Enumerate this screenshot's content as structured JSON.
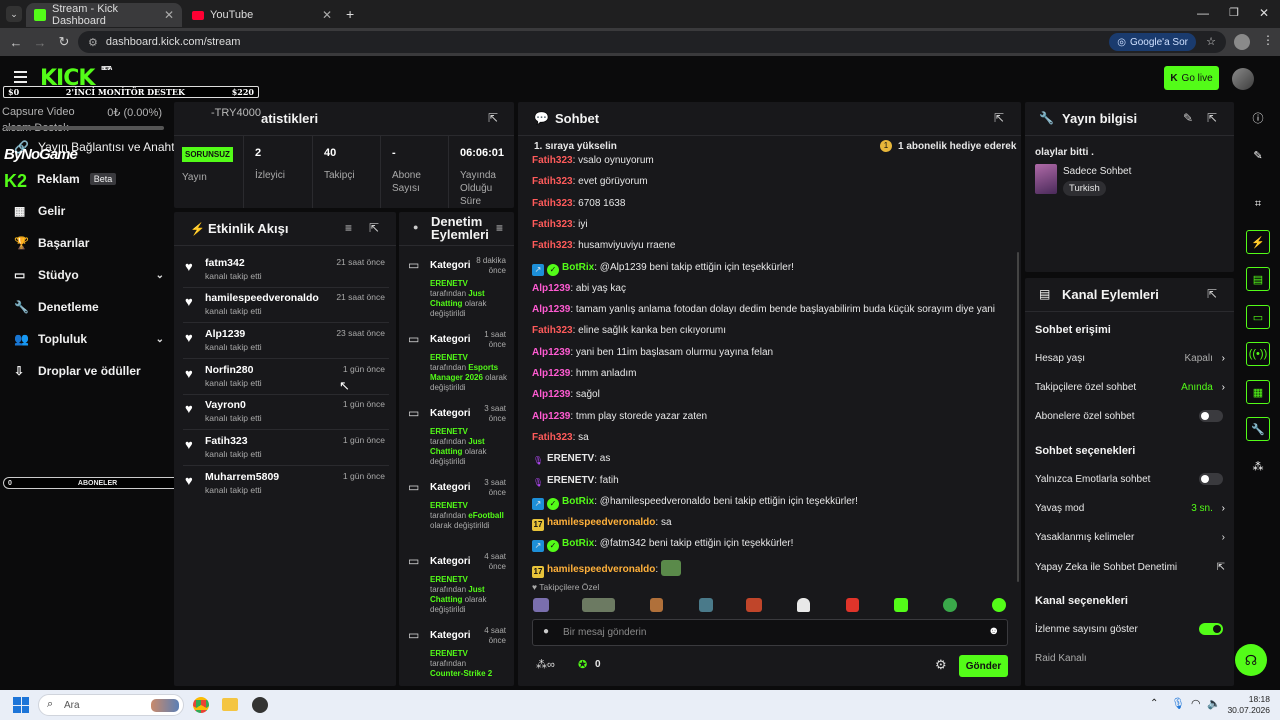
{
  "browser": {
    "tabs": [
      {
        "label": "Stream - Kick Dashboard",
        "active": true
      },
      {
        "label": "YouTube",
        "active": false
      }
    ],
    "url": "dashboard.kick.com/stream",
    "google_button": "Google'a Sor"
  },
  "header": {
    "logo": "KICK",
    "logo_tag": "BETA",
    "go_live": "Go live"
  },
  "overlay_top": {
    "left": "$0",
    "center": "2'İNCİ MONİTÖR DESTEK",
    "right": "$220"
  },
  "overlay_bottom": {
    "left": "0",
    "center": "ABONELER",
    "right": "10"
  },
  "overlay_ghost": {
    "line1": "Capsure Video",
    "line2": "0₺ (0.00%)",
    "line3": "alcam Destek",
    "line4": "ByNoGame",
    "try": "-TRY4000"
  },
  "sidebar": {
    "items": [
      {
        "label": "Yayın Bağlantısı ve Anahtarı"
      },
      {
        "label": "Reklam",
        "badge": "Beta"
      },
      {
        "label": "Gelir"
      },
      {
        "label": "Başarılar"
      },
      {
        "label": "Stüdyo"
      },
      {
        "label": "Denetleme"
      },
      {
        "label": "Topluluk"
      },
      {
        "label": "Droplar ve ödüller"
      }
    ]
  },
  "stats": {
    "title": "atistikleri",
    "items": [
      {
        "value": "SORUNSUZ",
        "label": "Yayın"
      },
      {
        "value": "2",
        "label": "İzleyici"
      },
      {
        "value": "40",
        "label": "Takipçi"
      },
      {
        "value": "-",
        "label": "Abone Sayısı"
      },
      {
        "value": "06:06:01",
        "label": "Yayında Olduğu Süre"
      }
    ]
  },
  "activity": {
    "title": "Etkinlik Akışı",
    "items": [
      {
        "name": "fatm342",
        "sub": "kanalı takip etti",
        "time": "21 saat önce"
      },
      {
        "name": "hamilespeedveronaldo",
        "sub": "kanalı takip etti",
        "time": "21 saat önce"
      },
      {
        "name": "Alp1239",
        "sub": "kanalı takip etti",
        "time": "23 saat önce"
      },
      {
        "name": "Norfin280",
        "sub": "kanalı takip etti",
        "time": "1 gün önce"
      },
      {
        "name": "Vayron0",
        "sub": "kanalı takip etti",
        "time": "1 gün önce"
      },
      {
        "name": "Fatih323",
        "sub": "kanalı takip etti",
        "time": "1 gün önce"
      },
      {
        "name": "Muharrem5809",
        "sub": "kanalı takip etti",
        "time": "1 gün önce"
      }
    ]
  },
  "moderation": {
    "title": "Denetim Eylemleri",
    "items": [
      {
        "kind": "Kategori",
        "time": "8 dakika önce",
        "actor": "ERENETV",
        "pre": "tarafından",
        "value": "Just Chatting",
        "post": "olarak değiştirildi"
      },
      {
        "kind": "Kategori",
        "time": "1 saat önce",
        "actor": "ERENETV",
        "pre": "tarafından",
        "value": "Esports Manager 2026",
        "post": "olarak değiştirildi"
      },
      {
        "kind": "Kategori",
        "time": "3 saat önce",
        "actor": "ERENETV",
        "pre": "tarafından",
        "value": "Just Chatting",
        "post": "olarak değiştirildi"
      },
      {
        "kind": "Kategori",
        "time": "3 saat önce",
        "actor": "ERENETV",
        "pre": "tarafından",
        "value": "eFootball",
        "post": "olarak değiştirildi"
      },
      {
        "kind": "Kategori",
        "time": "4 saat önce",
        "actor": "ERENETV",
        "pre": "tarafından",
        "value": "Just Chatting",
        "post": "olarak değiştirildi"
      },
      {
        "kind": "Kategori",
        "time": "4 saat önce",
        "actor": "ERENETV",
        "pre": "tarafından",
        "value": "Counter-Strike 2",
        "post": ""
      }
    ]
  },
  "chat": {
    "title": "Sohbet",
    "pinned_left": "1. sıraya yükselin",
    "pinned_right": "1 abonelik hediye ederek",
    "messages": [
      {
        "user": "Fatih323",
        "color": "red",
        "text": "vsalo oynuyorum"
      },
      {
        "user": "Fatih323",
        "color": "red",
        "text": "evet görüyorum"
      },
      {
        "user": "Fatih323",
        "color": "red",
        "text": "6708 1638"
      },
      {
        "user": "Fatih323",
        "color": "red",
        "text": "iyi"
      },
      {
        "user": "Fatih323",
        "color": "red",
        "text": "husamviyuviyu rraene"
      },
      {
        "user": "BotRix",
        "color": "green",
        "text": "@Alp1239 beni takip ettiğin için teşekkürler!",
        "bot": true
      },
      {
        "user": "Alp1239",
        "color": "pink",
        "text": "abi yaş kaç"
      },
      {
        "user": "Alp1239",
        "color": "pink",
        "text": "tamam yanlış anlama fotodan dolayı dedim bende başlayabilirim buda küçük sorayım diye yani"
      },
      {
        "user": "Fatih323",
        "color": "red",
        "text": "eline sağlık kanka ben cıkıyorumı"
      },
      {
        "user": "Alp1239",
        "color": "pink",
        "text": "yani ben 11im başlasam olurmu yayına felan"
      },
      {
        "user": "Alp1239",
        "color": "pink",
        "text": "hmm anladım"
      },
      {
        "user": "Alp1239",
        "color": "pink",
        "text": "sağol"
      },
      {
        "user": "Alp1239",
        "color": "pink",
        "text": "tmm play storede yazar zaten"
      },
      {
        "user": "Fatih323",
        "color": "red",
        "text": "sa"
      },
      {
        "user": "ERENETV",
        "color": "white",
        "text": "as",
        "mic": true
      },
      {
        "user": "ERENETV",
        "color": "white",
        "text": "fatih",
        "mic": true
      },
      {
        "user": "BotRix",
        "color": "green",
        "text": "@hamilespeedveronaldo beni takip ettiğin için teşekkürler!",
        "bot": true
      },
      {
        "user": "hamilespeedveronaldo",
        "color": "orange",
        "text": "sa",
        "sub": "17"
      },
      {
        "user": "BotRix",
        "color": "green",
        "text": "@fatm342 beni takip ettiğin için teşekkürler!",
        "bot": true
      },
      {
        "user": "hamilespeedveronaldo",
        "color": "orange",
        "text": "",
        "sub": "17",
        "emote": true
      }
    ],
    "followers_only": "Takipçilere Özel",
    "input_placeholder": "Bir mesaj gönderin",
    "send": "Gönder",
    "count": "0"
  },
  "stream_info": {
    "title": "Yayın bilgisi",
    "text": "olaylar bitti .",
    "category": "Sadece Sohbet",
    "tag": "Turkish"
  },
  "channel_actions": {
    "title": "Kanal Eylemleri",
    "sections": [
      {
        "title": "Sohbet erişimi"
      },
      {
        "title": "Sohbet seçenekleri"
      },
      {
        "title": "Kanal seçenekleri"
      }
    ],
    "rows": [
      {
        "label": "Hesap yaşı",
        "value": "Kapalı"
      },
      {
        "label": "Takipçilere özel sohbet",
        "value": "Anında"
      },
      {
        "label": "Abonelere özel sohbet",
        "toggle": false
      },
      {
        "label": "Yalnızca Emotlarla sohbet",
        "toggle": false
      },
      {
        "label": "Yavaş mod",
        "value": "3 sn."
      },
      {
        "label": "Yasaklanmış kelimeler"
      },
      {
        "label": "Yapay Zeka ile Sohbet Denetimi"
      },
      {
        "label": "İzlenme sayısını göster",
        "toggle": true
      },
      {
        "label": "Raid Kanalı"
      }
    ]
  },
  "taskbar": {
    "search": "Ara",
    "time": "18:18",
    "date": "30.07.2026"
  },
  "colors": {
    "accent": "#53fc18",
    "panel": "#18181b",
    "bg": "#0b0b0c"
  }
}
